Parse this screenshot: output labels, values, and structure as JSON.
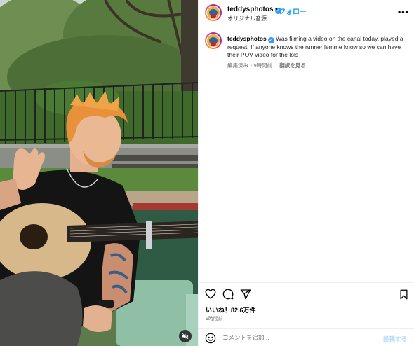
{
  "post": {
    "username": "teddysphotos",
    "separator": "•",
    "follow_label": "フォロー",
    "audio_label": "オリジナル音源",
    "more_icon": "more-horizontal-icon",
    "verified_icon": "✓"
  },
  "caption": {
    "username": "teddysphotos",
    "text": "Was filming a video on the canal today, played a request. If anyone knows the runner lemme know so we can have their POV video for the lols",
    "edited_label": "編集済み",
    "separator": "・",
    "time_ago": "9時間前",
    "translate_label": "翻訳を見る"
  },
  "actions": {
    "like_icon": "heart-icon",
    "comment_icon": "comment-icon",
    "share_icon": "send-icon",
    "save_icon": "bookmark-icon"
  },
  "stats": {
    "likes": "いいね！82.6万件",
    "time_ago": "9時間前"
  },
  "comment": {
    "placeholder": "コメントを追加...",
    "post_label": "投稿する"
  },
  "colors": {
    "accent": "#0095f6",
    "verified": "#3897f0",
    "post_disabled": "#b3dbff",
    "muted_text": "#737373"
  }
}
